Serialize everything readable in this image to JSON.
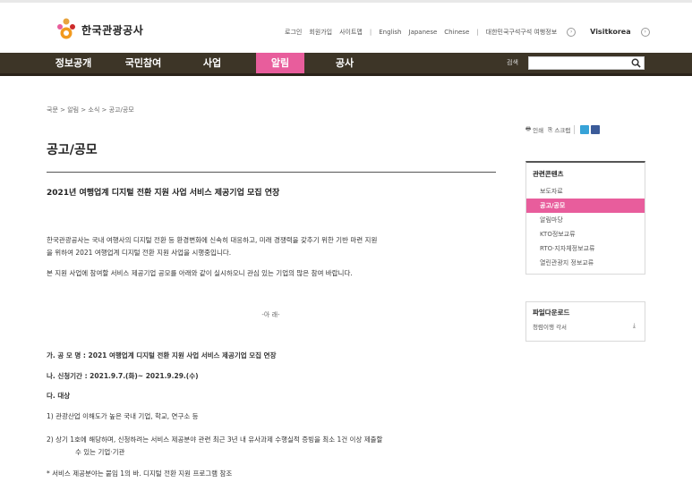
{
  "header": {
    "logo_text": "한국관광공사",
    "util_links": [
      "로그인",
      "회원가입",
      "사이트맵"
    ],
    "lang_links": [
      "English",
      "Japanese",
      "Chinese"
    ],
    "travel_info": "대한민국구석구석 여행정보",
    "visitkorea": "Visitkorea",
    "arrow": "›"
  },
  "gnb": {
    "items": [
      {
        "label": "정보공개"
      },
      {
        "label": "국민참여"
      },
      {
        "label": "사업"
      },
      {
        "label": "알림"
      },
      {
        "label": "공사"
      }
    ],
    "search_label": "검색",
    "search_value": ""
  },
  "breadcrumb": "국문 > 알림 > 소식 > 공고/공모",
  "page_title": "공고/공모",
  "post": {
    "title": "2021년 여행업계 디지털 전환 지원 사업 서비스 제공기업 모집 연장",
    "para1_line1": "한국관광공사는 국내 여행사의 디지털 전환 등 환경변화에 신속히 대응하고, 미래 경쟁력을 갖추기 위한 기반 마련 지원",
    "para1_line2": "을 위하여 2021 여행업계 디지털 전환 지원 사업을 시행중입니다.",
    "para2": "본 지원 사업에 참여할 서비스 제공기업 공모를 아래와 같이 실시하오니 관심 있는 기업의 많은 참여 바랍니다.",
    "center_mark": "-아 래-",
    "item_ga": "가. 공 모 명 : 2021 여행업계 디지털 전환 지원 사업 서비스 제공기업 모집 연장",
    "item_na": "나. 신청기간 : 2021.9.7.(화)~ 2021.9.29.(수)",
    "item_da": "다. 대상",
    "sub1": "1) 관광산업 이해도가 높은 국내 기업, 학교, 연구소 등",
    "sub2_line1": "2) 상기 1호에 해당하며, 신청하려는 서비스 제공분야 관련 최근 3년 내 유사과제 수행실적 증빙을 최소 1건 이상 제출할",
    "sub2_line2": "수 있는 기업·기관",
    "note": "* 서비스 제공분야는 붙임 1의 바. 디지털 전환 지원 프로그램 참조"
  },
  "tools": {
    "print": "인쇄",
    "scrap": "스크랩"
  },
  "sidebar": {
    "heading": "관련콘텐츠",
    "items": [
      {
        "label": "보도자료"
      },
      {
        "label": "공고/공모"
      },
      {
        "label": "알림마당"
      },
      {
        "label": "KTO정보교류"
      },
      {
        "label": "RTO·지자체정보교류"
      },
      {
        "label": "열린관광지 정보교류"
      }
    ]
  },
  "download": {
    "heading": "파일다운로드",
    "file": "청렴이행 각서",
    "icon": "⤓"
  },
  "colors": {
    "nav_bg": "#3d3527",
    "accent_pink": "#e85d9c"
  }
}
